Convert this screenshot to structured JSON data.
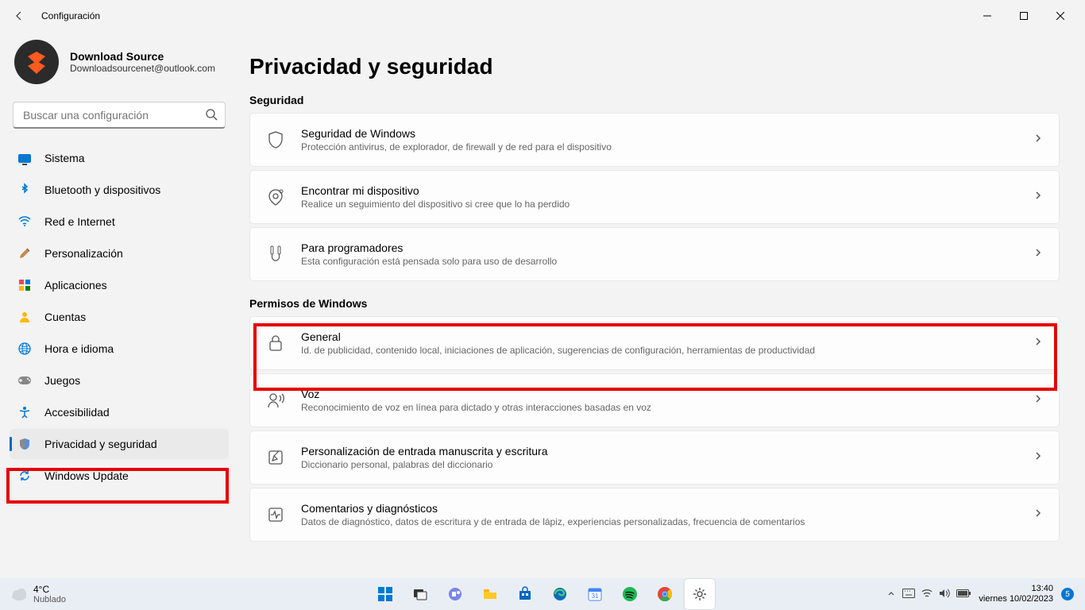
{
  "window": {
    "title": "Configuración"
  },
  "user": {
    "name": "Download Source",
    "email": "Downloadsourcenet@outlook.com"
  },
  "search": {
    "placeholder": "Buscar una configuración"
  },
  "sidebar": {
    "items": [
      {
        "label": "Sistema",
        "icon": "monitor"
      },
      {
        "label": "Bluetooth y dispositivos",
        "icon": "bluetooth"
      },
      {
        "label": "Red e Internet",
        "icon": "wifi"
      },
      {
        "label": "Personalización",
        "icon": "brush"
      },
      {
        "label": "Aplicaciones",
        "icon": "grid"
      },
      {
        "label": "Cuentas",
        "icon": "person"
      },
      {
        "label": "Hora e idioma",
        "icon": "globe"
      },
      {
        "label": "Juegos",
        "icon": "gamepad"
      },
      {
        "label": "Accesibilidad",
        "icon": "accessibility"
      },
      {
        "label": "Privacidad y seguridad",
        "icon": "shield",
        "active": true
      },
      {
        "label": "Windows Update",
        "icon": "update"
      }
    ]
  },
  "main": {
    "title": "Privacidad y seguridad",
    "sections": [
      {
        "title": "Seguridad",
        "items": [
          {
            "title": "Seguridad de Windows",
            "sub": "Protección antivirus, de explorador, de firewall y de red para el dispositivo",
            "icon": "shield"
          },
          {
            "title": "Encontrar mi dispositivo",
            "sub": "Realice un seguimiento del dispositivo si cree que lo ha perdido",
            "icon": "location"
          },
          {
            "title": "Para programadores",
            "sub": "Esta configuración está pensada solo para uso de desarrollo",
            "icon": "dev"
          }
        ]
      },
      {
        "title": "Permisos de Windows",
        "items": [
          {
            "title": "General",
            "sub": "Id. de publicidad, contenido local, iniciaciones de aplicación, sugerencias de configuración, herramientas de productividad",
            "icon": "lock"
          },
          {
            "title": "Voz",
            "sub": "Reconocimiento de voz en línea para dictado y otras interacciones basadas en voz",
            "icon": "voice"
          },
          {
            "title": "Personalización de entrada manuscrita y escritura",
            "sub": "Diccionario personal, palabras del diccionario",
            "icon": "pen"
          },
          {
            "title": "Comentarios y diagnósticos",
            "sub": "Datos de diagnóstico, datos de escritura y de entrada de lápiz, experiencias personalizadas, frecuencia de comentarios",
            "icon": "diag"
          }
        ]
      }
    ]
  },
  "taskbar": {
    "weather": {
      "temp": "4°C",
      "cond": "Nublado"
    },
    "clock": {
      "time": "13:40",
      "date": "viernes 10/02/2023"
    },
    "notif_count": "5"
  }
}
